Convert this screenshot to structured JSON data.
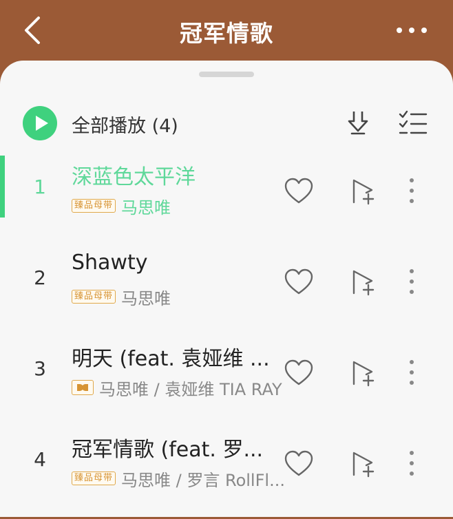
{
  "header": {
    "title": "冠军情歌",
    "back_icon": "back-chevron-icon",
    "more_icon": "more-dots-icon"
  },
  "playlist": {
    "play_all_label": "全部播放 (4)",
    "accent_color": "#3fd17e"
  },
  "tracks": [
    {
      "index": "1",
      "title": "深蓝色太平洋",
      "badge": "臻品母带",
      "artist": "马思唯",
      "active": true
    },
    {
      "index": "2",
      "title": "Shawty",
      "badge": "臻品母带",
      "artist": "马思唯",
      "active": false
    },
    {
      "index": "3",
      "title": "明天 (feat. 袁娅维 ...",
      "badge": "",
      "artist": "马思唯 / 袁娅维 TIA RAY",
      "active": false
    },
    {
      "index": "4",
      "title": "冠军情歌 (feat. 罗...",
      "badge": "臻品母带",
      "artist": "马思唯 / 罗言 RollFl...",
      "active": false
    }
  ]
}
